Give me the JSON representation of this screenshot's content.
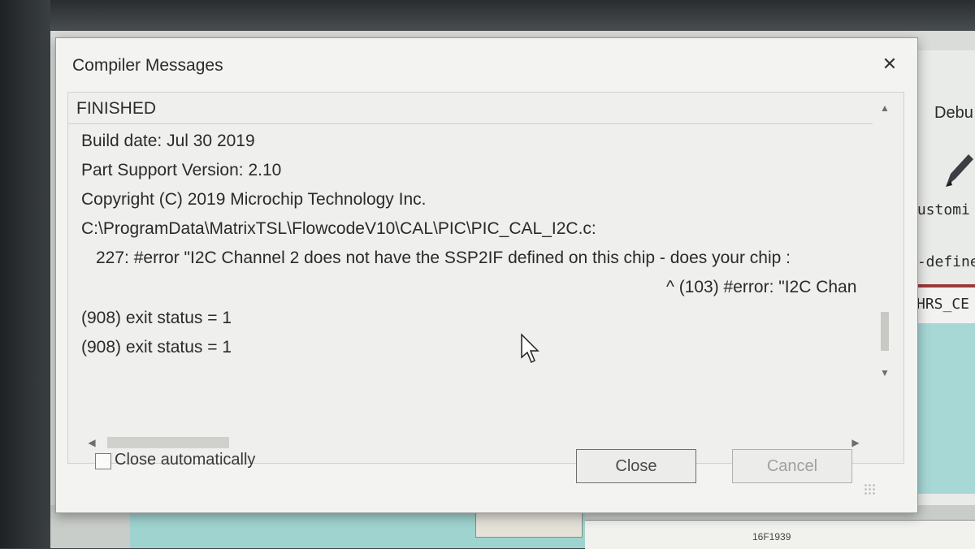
{
  "dialog": {
    "title": "Compiler Messages",
    "close_glyph": "✕",
    "status": "FINISHED",
    "lines": [
      "Build date: Jul 30 2019",
      "Part Support Version: 2.10",
      "Copyright (C) 2019 Microchip Technology Inc.",
      "C:\\ProgramData\\MatrixTSL\\FlowcodeV10\\CAL\\PIC\\PIC_CAL_I2C.c:",
      "227:        #error \"I2C Channel 2 does not have the SSP2IF defined on this chip - does your chip :",
      "^ (103) #error: \"I2C Chan",
      "(908) exit status = 1",
      "(908) exit status = 1"
    ],
    "close_automatically_label": "Close automatically",
    "close_automatically_checked": false,
    "close_button": "Close",
    "cancel_button": "Cancel",
    "scroll_up_glyph": "▲",
    "scroll_down_glyph": "▼",
    "scroll_left_glyph": "◀",
    "scroll_right_glyph": "▶"
  },
  "background_app": {
    "debug_label": "Debu",
    "customize_label": "Customi",
    "user_defined_label": "r-definec",
    "hrs_label": "HRS_CE",
    "chip_label": "16F1939"
  },
  "icons": {
    "close": "close-icon",
    "pencil": "pencil-icon",
    "cursor": "mouse-pointer-icon"
  }
}
